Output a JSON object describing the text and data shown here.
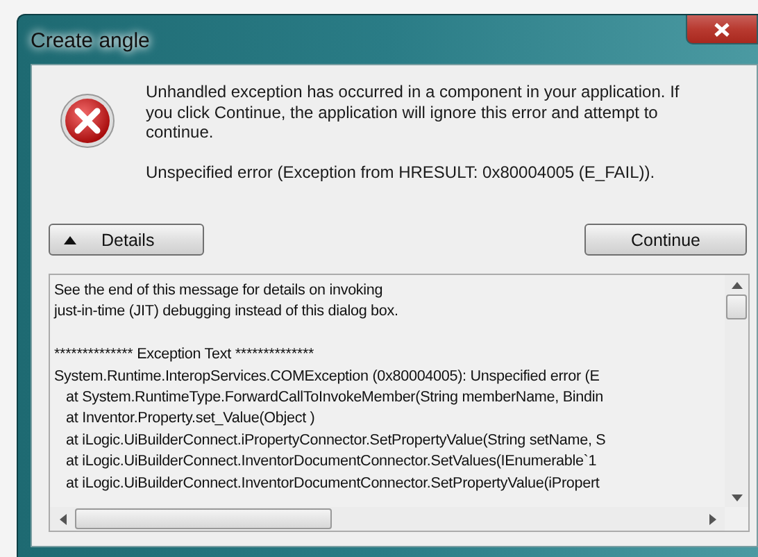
{
  "window": {
    "title": "Create angle"
  },
  "message": "Unhandled exception has occurred in a component in your application. If you click Continue, the application will ignore this error and attempt to continue.",
  "error": "Unspecified error (Exception from HRESULT: 0x80004005 (E_FAIL)).",
  "buttons": [
    {
      "kind": "details",
      "label": "Details",
      "expanded": true
    },
    {
      "kind": "continue",
      "label": "Continue"
    }
  ],
  "details_blocks": [
    [
      "See the end of this message for details on invoking",
      "just-in-time (JIT) debugging instead of this dialog box."
    ],
    [
      "************** Exception Text **************",
      "System.Runtime.InteropServices.COMException (0x80004005): Unspecified error (E",
      "   at System.RuntimeType.ForwardCallToInvokeMember(String memberName, Bindin",
      "   at Inventor.Property.set_Value(Object )",
      "   at iLogic.UiBuilderConnect.iPropertyConnector.SetPropertyValue(String setName, S",
      "   at iLogic.UiBuilderConnect.InventorDocumentConnector.SetValues(IEnumerable`1",
      "   at iLogic.UiBuilderConnect.InventorDocumentConnector.SetPropertyValue(iPropert"
    ]
  ]
}
